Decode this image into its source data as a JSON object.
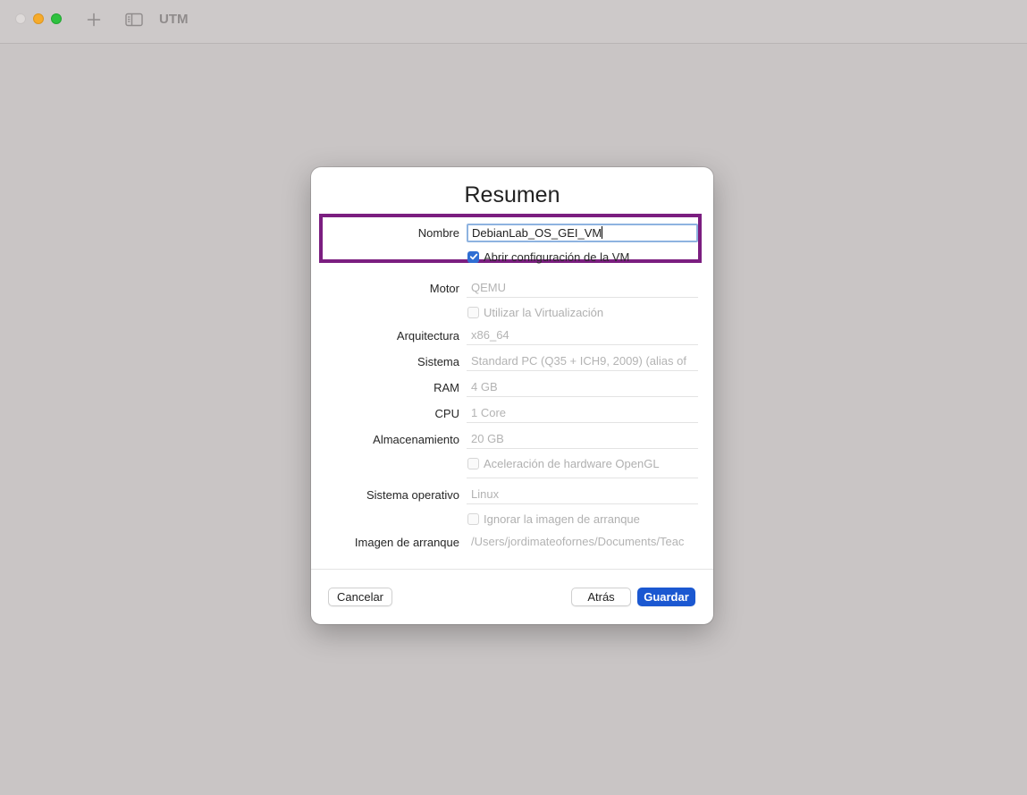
{
  "window": {
    "title": "UTM"
  },
  "dialog": {
    "title": "Resumen",
    "name_label": "Nombre",
    "name_value": "DebianLab_OS_GEI_VM",
    "open_config_label": "Abrir configuración de la VM",
    "engine_label": "Motor",
    "engine_value": "QEMU",
    "virtualization_label": "Utilizar la Virtualización",
    "architecture_label": "Arquitectura",
    "architecture_value": "x86_64",
    "system_label": "Sistema",
    "system_value": "Standard PC (Q35 + ICH9, 2009) (alias of",
    "ram_label": "RAM",
    "ram_value": "4 GB",
    "cpu_label": "CPU",
    "cpu_value": "1 Core",
    "storage_label": "Almacenamiento",
    "storage_value": "20 GB",
    "opengl_label": "Aceleración de hardware OpenGL",
    "os_label": "Sistema operativo",
    "os_value": "Linux",
    "skip_boot_label": "Ignorar la imagen de arranque",
    "boot_image_label": "Imagen de arranque",
    "boot_image_value": "/Users/jordimateofornes/Documents/Teac"
  },
  "buttons": {
    "cancel": "Cancelar",
    "back": "Atrás",
    "save": "Guardar"
  },
  "colors": {
    "accent": "#1b58d1",
    "highlight": "#7b1e80"
  }
}
